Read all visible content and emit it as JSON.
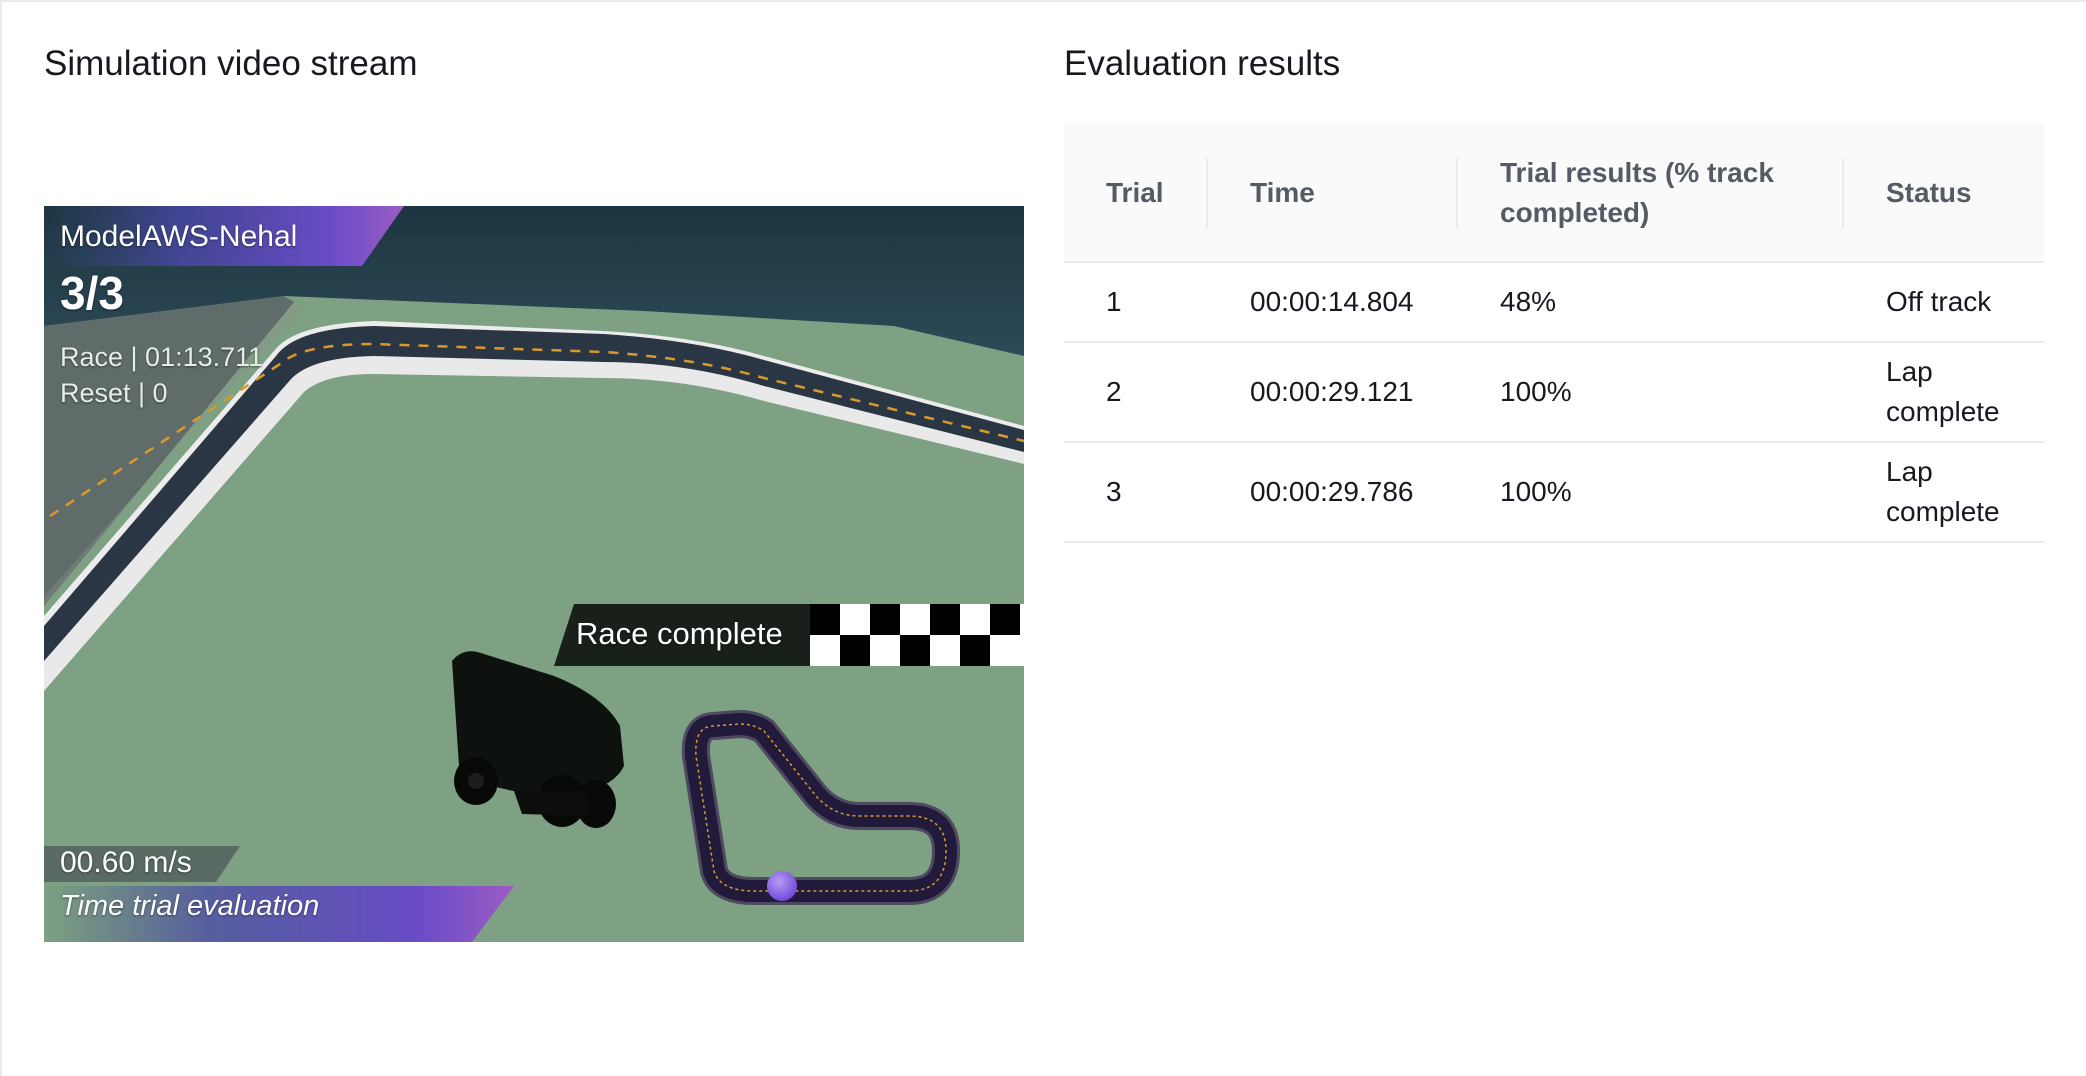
{
  "video": {
    "heading": "Simulation video stream",
    "model_name": "ModelAWS-Nehal",
    "trial_counter": "3/3",
    "race_time": "Race | 01:13.711",
    "reset_count": "Reset | 0",
    "race_status": "Race complete",
    "speed": "00.60 m/s",
    "mode": "Time trial evaluation"
  },
  "results": {
    "heading": "Evaluation results",
    "columns": [
      "Trial",
      "Time",
      "Trial results (% track completed)",
      "Status"
    ],
    "rows": [
      {
        "trial": "1",
        "time": "00:00:14.804",
        "result": "48%",
        "status": "Off track"
      },
      {
        "trial": "2",
        "time": "00:00:29.121",
        "result": "100%",
        "status": "Lap complete"
      },
      {
        "trial": "3",
        "time": "00:00:29.786",
        "result": "100%",
        "status": "Lap complete"
      }
    ]
  },
  "colors": {
    "grass": "#7ea083",
    "track": "#2e3a48",
    "wall": "#1f3844",
    "accent_purple": "#5a4fc4",
    "header_bg": "#fafafa"
  }
}
